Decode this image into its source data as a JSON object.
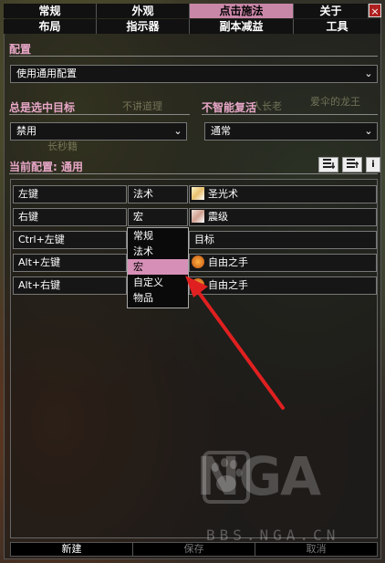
{
  "tabs_row1": [
    "常规",
    "外观",
    "点击施法",
    "关于"
  ],
  "tabs_row2": [
    "布局",
    "指示器",
    "副本减益",
    "工具"
  ],
  "close_label": "×",
  "config": {
    "label": "配置",
    "value": "使用通用配置",
    "arrow": "⌄"
  },
  "always_target": {
    "label": "总是选中目标",
    "value": "禁用"
  },
  "smart_res": {
    "label": "不智能复活",
    "value": "通常"
  },
  "current": {
    "label": "当前配置: 通用"
  },
  "ghost_texts": [
    "不讲道理",
    "人长老",
    "爱伞的龙王",
    "长秒籍"
  ],
  "bindings": [
    {
      "key": "左键",
      "type": "法术",
      "action": "圣光术"
    },
    {
      "key": "右键",
      "type": "宏",
      "action": "震级"
    },
    {
      "key": "Ctrl+左键",
      "type": "",
      "action": "目标"
    },
    {
      "key": "Alt+左键",
      "type": "",
      "action": "自由之手"
    },
    {
      "key": "Alt+右键",
      "type": "",
      "action": "自由之手"
    }
  ],
  "menu_items": [
    "常规",
    "法术",
    "宏",
    "自定义",
    "物品"
  ],
  "menu_selected": "宏",
  "buttons": {
    "new": "新建",
    "save": "保存",
    "cancel": "取消"
  },
  "watermark": {
    "logo": "NGA",
    "site": "BBS.NGA.CN"
  },
  "colors": {
    "accent": "#c987a8",
    "section": "#e8a7c8",
    "arrow": "#e02020",
    "close": "#b02020"
  }
}
